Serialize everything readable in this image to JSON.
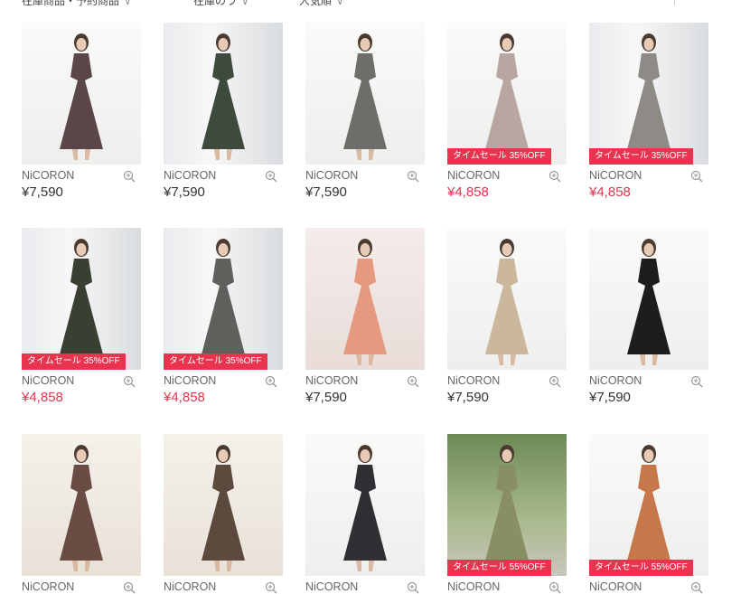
{
  "filters": [
    {
      "label": "在庫商品・予約商品",
      "chev": "∨"
    },
    {
      "label": "在庫のラ",
      "chev": "∨"
    },
    {
      "label": "人気順",
      "chev": "∨"
    }
  ],
  "view_toggle": {
    "grid_small_icon": "grid-3x3-icon",
    "grid_large_icon": "grid-2x2-icon"
  },
  "colors": {
    "sale": "#e8344e",
    "text": "#333333",
    "brand": "#666666"
  },
  "products": [
    {
      "brand": "NiCORON",
      "price": "¥7,590",
      "sale": false,
      "badge": "",
      "dress": "#5a4648",
      "bg": "white"
    },
    {
      "brand": "NiCORON",
      "price": "¥7,590",
      "sale": false,
      "badge": "",
      "dress": "#3f4a3e",
      "bg": "window"
    },
    {
      "brand": "NiCORON",
      "price": "¥7,590",
      "sale": false,
      "badge": "",
      "dress": "#6d6e6a",
      "bg": "white"
    },
    {
      "brand": "NiCORON",
      "price": "¥4,858",
      "sale": true,
      "badge": "タイムセール  35%OFF",
      "dress": "#b9a6a3",
      "bg": "white"
    },
    {
      "brand": "NiCORON",
      "price": "¥4,858",
      "sale": true,
      "badge": "タイムセール  35%OFF",
      "dress": "#8e8b87",
      "bg": "window"
    },
    {
      "brand": "NiCORON",
      "price": "¥4,858",
      "sale": true,
      "badge": "タイムセール  35%OFF",
      "dress": "#3a4031",
      "bg": "window"
    },
    {
      "brand": "NiCORON",
      "price": "¥4,858",
      "sale": true,
      "badge": "タイムセール  35%OFF",
      "dress": "#5f5f5b",
      "bg": "window"
    },
    {
      "brand": "NiCORON",
      "price": "¥7,590",
      "sale": false,
      "badge": "",
      "dress": "#e59a80",
      "bg": "studio"
    },
    {
      "brand": "NiCORON",
      "price": "¥7,590",
      "sale": false,
      "badge": "",
      "dress": "#cbb79c",
      "bg": "white"
    },
    {
      "brand": "NiCORON",
      "price": "¥7,590",
      "sale": false,
      "badge": "",
      "dress": "#1d1d1d",
      "bg": "white"
    },
    {
      "brand": "NiCORON",
      "price": "",
      "sale": false,
      "badge": "",
      "dress": "#6b4c45",
      "bg": "beige"
    },
    {
      "brand": "NiCORON",
      "price": "",
      "sale": false,
      "badge": "",
      "dress": "#5b4a3d",
      "bg": "beige"
    },
    {
      "brand": "NiCORON",
      "price": "",
      "sale": false,
      "badge": "",
      "dress": "#2f2f34",
      "bg": "white"
    },
    {
      "brand": "NiCORON",
      "price": "",
      "sale": true,
      "badge": "タイムセール  55%OFF",
      "dress": "#8a8f63",
      "bg": "green"
    },
    {
      "brand": "NiCORON",
      "price": "",
      "sale": true,
      "badge": "タイムセール  55%OFF",
      "dress": "#c7784a",
      "bg": "white"
    }
  ]
}
